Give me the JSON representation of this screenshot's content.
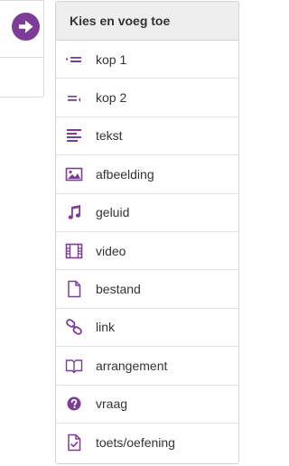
{
  "colors": {
    "accent": "#7d3c98",
    "header_bg": "#eeeeee",
    "border": "#d4d4d4"
  },
  "left_panel": {
    "action_icon": "arrow-right-circle-icon"
  },
  "menu": {
    "title": "Kies en voeg toe",
    "items": [
      {
        "label": "kop 1",
        "icon": "heading-1-icon"
      },
      {
        "label": "kop 2",
        "icon": "heading-2-icon"
      },
      {
        "label": "tekst",
        "icon": "text-align-icon"
      },
      {
        "label": "afbeelding",
        "icon": "image-icon"
      },
      {
        "label": "geluid",
        "icon": "music-note-icon"
      },
      {
        "label": "video",
        "icon": "film-icon"
      },
      {
        "label": "bestand",
        "icon": "file-icon"
      },
      {
        "label": "link",
        "icon": "link-icon"
      },
      {
        "label": "arrangement",
        "icon": "book-open-icon"
      },
      {
        "label": "vraag",
        "icon": "question-circle-icon"
      },
      {
        "label": "toets/oefening",
        "icon": "file-check-icon"
      }
    ]
  }
}
